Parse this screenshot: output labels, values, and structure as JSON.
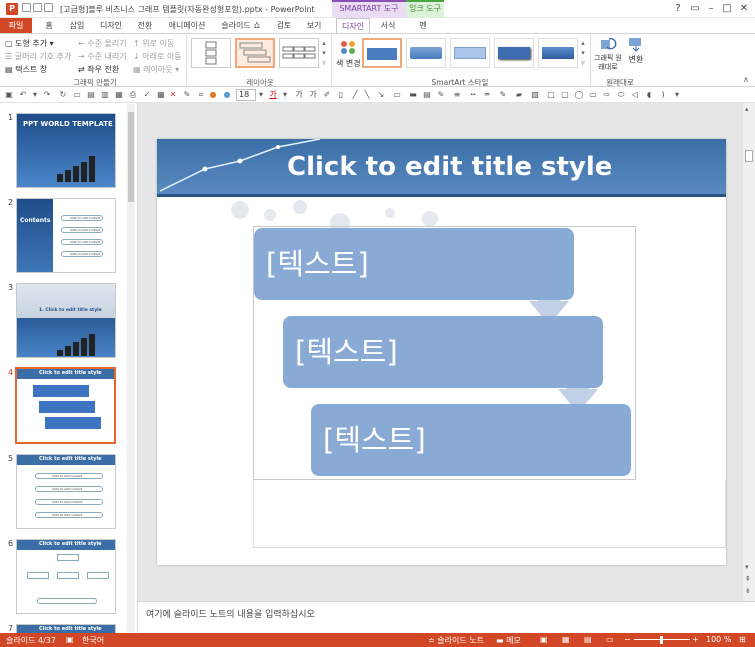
{
  "titlebar": {
    "document_title": "[고급형]블루 비즈니스 그래프 템플릿(자동완성형포함).pptx - PowerPoint",
    "ctx_smartart": "SMARTART 도구",
    "ctx_ink": "잉크 도구",
    "help": "?",
    "restore": "▭",
    "minimize": "–",
    "maximize": "□",
    "close": "✕"
  },
  "tabs": [
    "파일",
    "홈",
    "삽입",
    "디자인",
    "전환",
    "애니메이션",
    "슬라이드 쇼",
    "검토",
    "보기",
    "디자인",
    "서식",
    "펜"
  ],
  "ribbon": {
    "create_graphic": {
      "add_shape": "도형 추가",
      "add_bullet": "글머리 기호 추가",
      "text_pane": "텍스트 창",
      "promote": "수준 올리기",
      "demote": "수준 내리기",
      "right_to_left": "좌우 전환",
      "move_up": "위로 이동",
      "move_down": "아래로 이동",
      "layout": "레이아웃",
      "label": "그래픽 만들기"
    },
    "layouts_label": "레이아웃",
    "change_colors": "색 변경",
    "styles_label": "SmartArt 스타일",
    "reset_graphic": "그래픽 원래대로",
    "convert": "변환",
    "reset_label": "원래대로"
  },
  "qat": {
    "font_size": "18"
  },
  "thumbnails": [
    {
      "num": "1",
      "title": "PPT WORLD TEMPLATE"
    },
    {
      "num": "2",
      "title": "Contents",
      "items": [
        "Click to add content",
        "Click to add content",
        "Click to add content",
        "Click to add content"
      ]
    },
    {
      "num": "3",
      "title": "1. Click to edit title style"
    },
    {
      "num": "4",
      "title": "Click to edit title style"
    },
    {
      "num": "5",
      "title": "Click to edit title style",
      "items": [
        "Click to add content",
        "Click to add content",
        "Click to add content",
        "Click to add content"
      ]
    },
    {
      "num": "6",
      "title": "Click to edit title style"
    },
    {
      "num": "7",
      "title": "Click to edit title style"
    }
  ],
  "slide": {
    "title": "Click to edit title style",
    "boxes": [
      "[텍스트]",
      "[텍스트]",
      "[텍스트]"
    ]
  },
  "notes": {
    "placeholder": "여기에 슬라이드 노트의 내용을 입력하십시오"
  },
  "status": {
    "slide_counter": "슬라이드 4/37",
    "language": "한국어",
    "notes_btn": "슬라이드 노트",
    "comments_btn": "메모",
    "zoom": "100 %"
  },
  "colors": {
    "accent": "#d24726",
    "smartart_box": "#8aaad6",
    "header": "#3b6ea6"
  }
}
